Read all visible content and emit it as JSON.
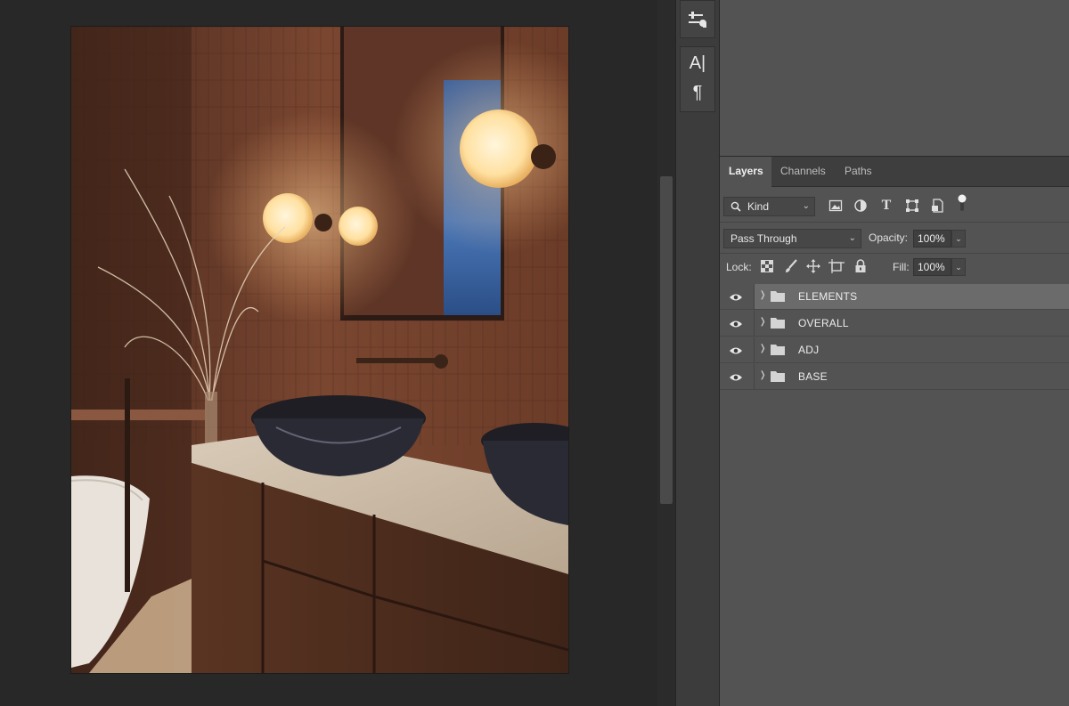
{
  "icons": {
    "properties": "properties-sliders-icon",
    "character": "character-type-icon",
    "paragraph": "paragraph-pilcrow-icon",
    "search": "search-icon",
    "filter_pixel": "image-filter-icon",
    "filter_adjustment": "adjustment-filter-icon",
    "filter_type": "type-filter-icon",
    "filter_shape": "shape-filter-icon",
    "filter_smart": "smart-object-filter-icon",
    "filter_toggle": "filter-toggle-icon",
    "lock_transparent": "lock-transparent-pixels-icon",
    "lock_image": "lock-image-pixels-icon",
    "lock_position": "lock-position-icon",
    "lock_artboard": "lock-artboard-icon",
    "lock_all": "lock-all-icon",
    "visibility": "eye-icon",
    "folder": "folder-icon",
    "expand": "chevron-right-icon"
  },
  "dock": {
    "character_glyph": "A|",
    "paragraph_glyph": "¶"
  },
  "layers_panel": {
    "tabs": [
      {
        "label": "Layers",
        "active": true
      },
      {
        "label": "Channels",
        "active": false
      },
      {
        "label": "Paths",
        "active": false
      }
    ],
    "filter": {
      "kind_label": "Kind"
    },
    "blend_mode": "Pass Through",
    "opacity_label": "Opacity:",
    "opacity_value": "100%",
    "lock_label": "Lock:",
    "fill_label": "Fill:",
    "fill_value": "100%",
    "layers": [
      {
        "name": "ELEMENTS",
        "type": "group",
        "visible": true,
        "selected": true
      },
      {
        "name": "OVERALL",
        "type": "group",
        "visible": true,
        "selected": false
      },
      {
        "name": "ADJ",
        "type": "group",
        "visible": true,
        "selected": false
      },
      {
        "name": "BASE",
        "type": "group",
        "visible": true,
        "selected": false
      }
    ]
  },
  "colors": {
    "panel_bg": "#535353",
    "workspace_bg": "#282828",
    "selected_layer": "#6b6b6b"
  }
}
